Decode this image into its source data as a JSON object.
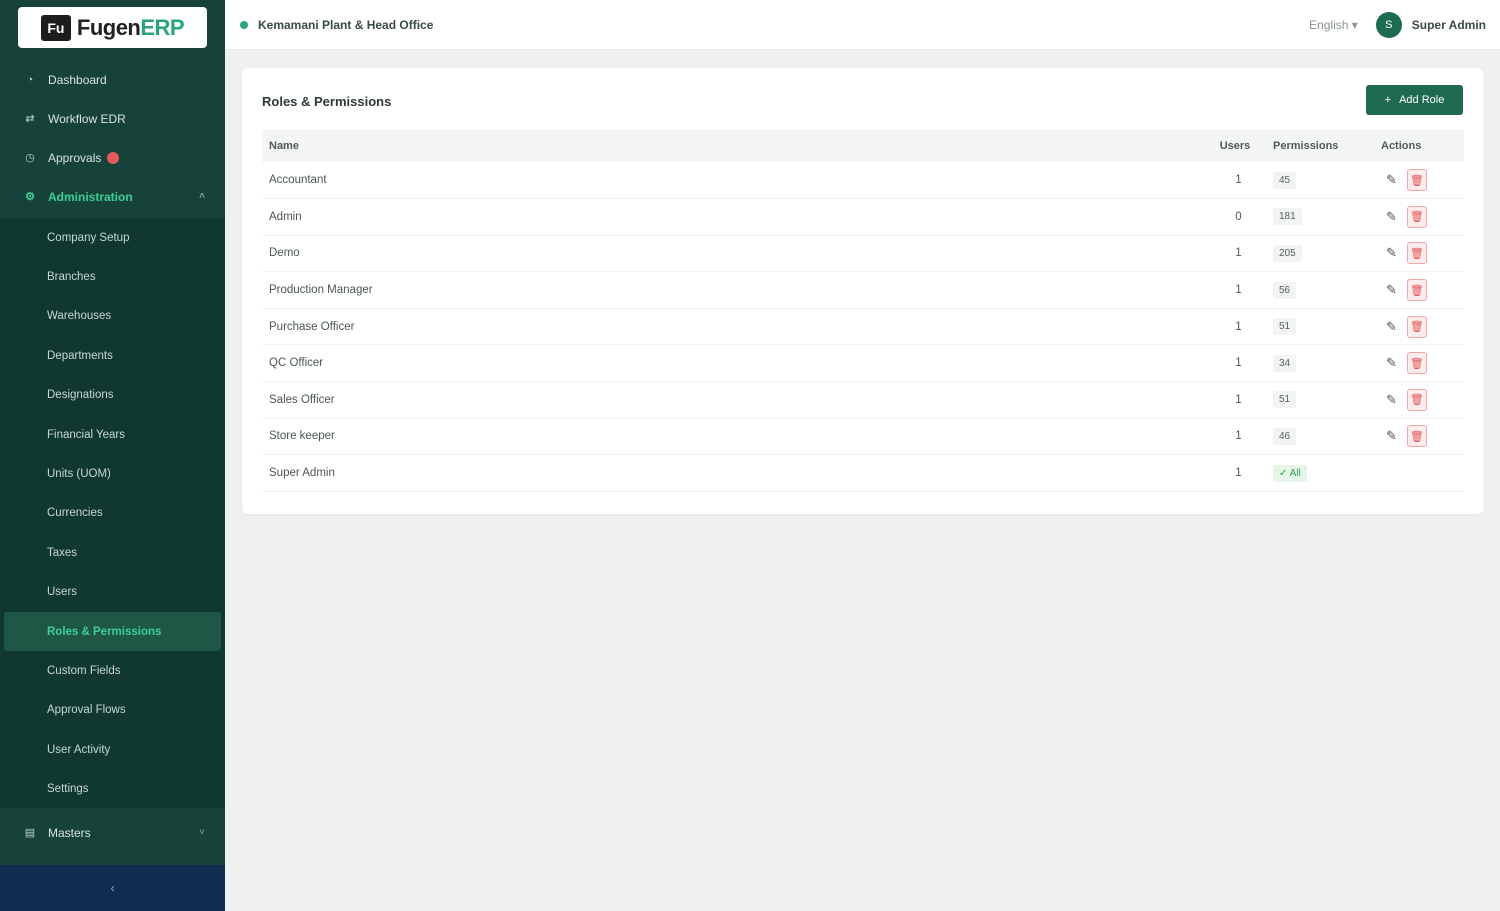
{
  "app": {
    "logo_mark": "Fu",
    "logo_name": "Fugen",
    "logo_suffix": "ERP"
  },
  "topbar": {
    "branch": "Kemamani Plant & Head Office",
    "language": "English ▾",
    "avatar_initial": "S",
    "user_name": "Super Admin"
  },
  "sidebar": {
    "items": [
      {
        "label": "Dashboard",
        "icon": "dashboard-icon"
      },
      {
        "label": "Workflow EDR",
        "icon": "workflow-icon"
      },
      {
        "label": "Approvals",
        "icon": "approval-icon"
      },
      {
        "label": "Administration",
        "icon": "admin-icon"
      }
    ],
    "submenu": [
      "Company Setup",
      "Branches",
      "Warehouses",
      "Departments",
      "Designations",
      "Financial Years",
      "Units (UOM)",
      "Currencies",
      "Taxes",
      "Users",
      "Roles & Permissions",
      "Custom Fields",
      "Approval Flows",
      "User Activity",
      "Settings"
    ],
    "bottom_item": "Masters",
    "collapse_icon": "‹"
  },
  "page": {
    "title": "Roles & Permissions",
    "add_button": "Add Role"
  },
  "table": {
    "headers": {
      "name": "Name",
      "users": "Users",
      "permissions": "Permissions",
      "actions": "Actions"
    },
    "rows": [
      {
        "name": "Accountant",
        "users": "1",
        "permissions": "45"
      },
      {
        "name": "Admin",
        "users": "0",
        "permissions": "181"
      },
      {
        "name": "Demo",
        "users": "1",
        "permissions": "205"
      },
      {
        "name": "Production Manager",
        "users": "1",
        "permissions": "56"
      },
      {
        "name": "Purchase Officer",
        "users": "1",
        "permissions": "51"
      },
      {
        "name": "QC Officer",
        "users": "1",
        "permissions": "34"
      },
      {
        "name": "Sales Officer",
        "users": "1",
        "permissions": "51"
      },
      {
        "name": "Store keeper",
        "users": "1",
        "permissions": "46"
      },
      {
        "name": "Super Admin",
        "users": "1",
        "permissions": "All"
      }
    ]
  },
  "colors": {
    "sidebar_bg": "#17423a",
    "accent": "#2aa579",
    "button": "#1f6b4f",
    "danger": "#e05555"
  }
}
